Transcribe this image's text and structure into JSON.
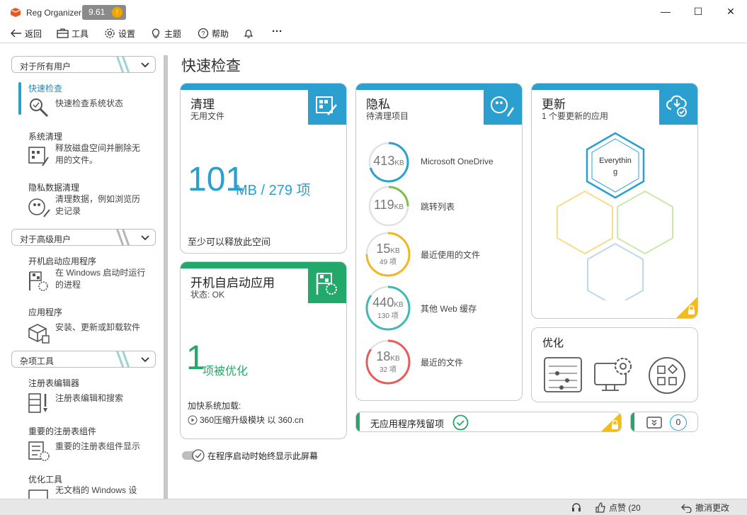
{
  "app": {
    "title": "Reg Organizer",
    "version": "9.61",
    "update_icon": "arrow-up-icon",
    "window_buttons": [
      "minimize",
      "maximize",
      "close"
    ]
  },
  "toolbar": {
    "back": "返回",
    "tools": "工具",
    "settings": "设置",
    "themes": "主题",
    "help": "帮助",
    "more": "···"
  },
  "sidebar": {
    "groups": [
      {
        "label": "对于所有用户"
      },
      {
        "label": "对于高级用户"
      },
      {
        "label": "杂项工具"
      }
    ],
    "items": [
      {
        "title": "快速检查",
        "desc": "快速检查系统状态",
        "icon": "magnifier-icon"
      },
      {
        "title": "系统清理",
        "desc": "释放磁盘空间并删除无用的文件。",
        "icon": "disk-cleanup-icon"
      },
      {
        "title": "隐私数据清理",
        "desc": "清理数据，例如浏览历史记录",
        "icon": "privacy-broom-icon"
      },
      {
        "title": "开机启动应用程序",
        "desc": "在 Windows 启动时运行的进程",
        "icon": "startup-flag-icon"
      },
      {
        "title": "应用程序",
        "desc": "安装、更新或卸载软件",
        "icon": "software-box-icon"
      },
      {
        "title": "注册表编辑器",
        "desc": "注册表编辑和搜索",
        "icon": "registry-editor-icon"
      },
      {
        "title": "重要的注册表组件",
        "desc": "重要的注册表组件显示",
        "icon": "registry-components-icon"
      },
      {
        "title": "优化工具",
        "desc": "无文档的 Windows 设",
        "icon": "tweaks-icon"
      }
    ]
  },
  "main": {
    "title": "快速检查",
    "cleanup": {
      "title": "清理",
      "subtitle": "无用文件",
      "size_value": "101",
      "size_unit": "MB / 279 项",
      "footer": "至少可以释放此空间"
    },
    "startup": {
      "title": "开机自启动应用",
      "subtitle": "状态: OK",
      "count": "1",
      "count_label": "项被优化",
      "footer_title": "加快系统加载:",
      "footer_link": "360压缩升级模块 以 360.cn"
    },
    "privacy": {
      "title": "隐私",
      "subtitle": "待清理项目",
      "items": [
        {
          "value": "413",
          "unit": "KB",
          "count": "",
          "label": "Microsoft OneDrive",
          "color": "#2b9fd0",
          "fill": 0.7
        },
        {
          "value": "119",
          "unit": "KB",
          "count": "",
          "label": "跳转列表",
          "color": "#7cc04a",
          "fill": 0.25
        },
        {
          "value": "15",
          "unit": "KB",
          "count": "49 项",
          "label": "最近使用的文件",
          "color": "#f2b620",
          "fill": 0.75
        },
        {
          "value": "440",
          "unit": "KB",
          "count": "130 项",
          "label": "其他 Web 缓存",
          "color": "#3fb8b8",
          "fill": 0.85
        },
        {
          "value": "18",
          "unit": "KB",
          "count": "32 项",
          "label": "最近的文件",
          "color": "#e85b5b",
          "fill": 0.85
        }
      ]
    },
    "updates": {
      "title": "更新",
      "subtitle": "1 个要更新的应用",
      "app_name": "Everything"
    },
    "optimize": {
      "title": "优化"
    },
    "leftovers": {
      "label": "无应用程序残留项"
    },
    "counter": {
      "value": "0"
    },
    "toggle_label": "在程序启动时始终显示此屏幕"
  },
  "statusbar": {
    "like": "点赞 (20",
    "undo": "撤消更改"
  },
  "colors": {
    "accent": "#2b9fd0",
    "green": "#22a86b",
    "yellow": "#f4bc1b"
  }
}
